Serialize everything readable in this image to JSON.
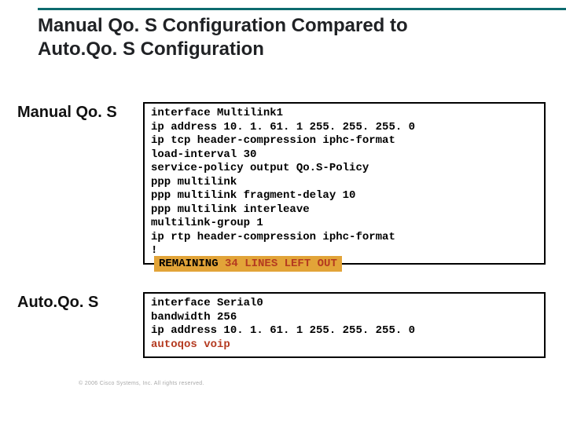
{
  "title": "Manual Qo. S Configuration Compared to Auto.Qo. S Configuration",
  "sections": {
    "manual": {
      "label": "Manual Qo. S",
      "code": "interface Multilink1\nip address 10. 1. 61. 1 255. 255. 255. 0\nip tcp header-compression iphc-format\nload-interval 30\nservice-policy output Qo.S-Policy\nppp multilink\nppp multilink fragment-delay 10\nppp multilink interleave\nmultilink-group 1\nip rtp header-compression iphc-format\n!"
    },
    "auto": {
      "label": "Auto.Qo. S",
      "code_plain": "interface Serial0\nbandwidth 256\nip address 10. 1. 61. 1 255. 255. 255. 0",
      "code_highlight": "autoqos voip"
    }
  },
  "remaining": {
    "prefix": "REMAINING ",
    "accent": "34 LINES LEFT OUT"
  },
  "copyright": "© 2006 Cisco Systems, Inc. All rights reserved."
}
